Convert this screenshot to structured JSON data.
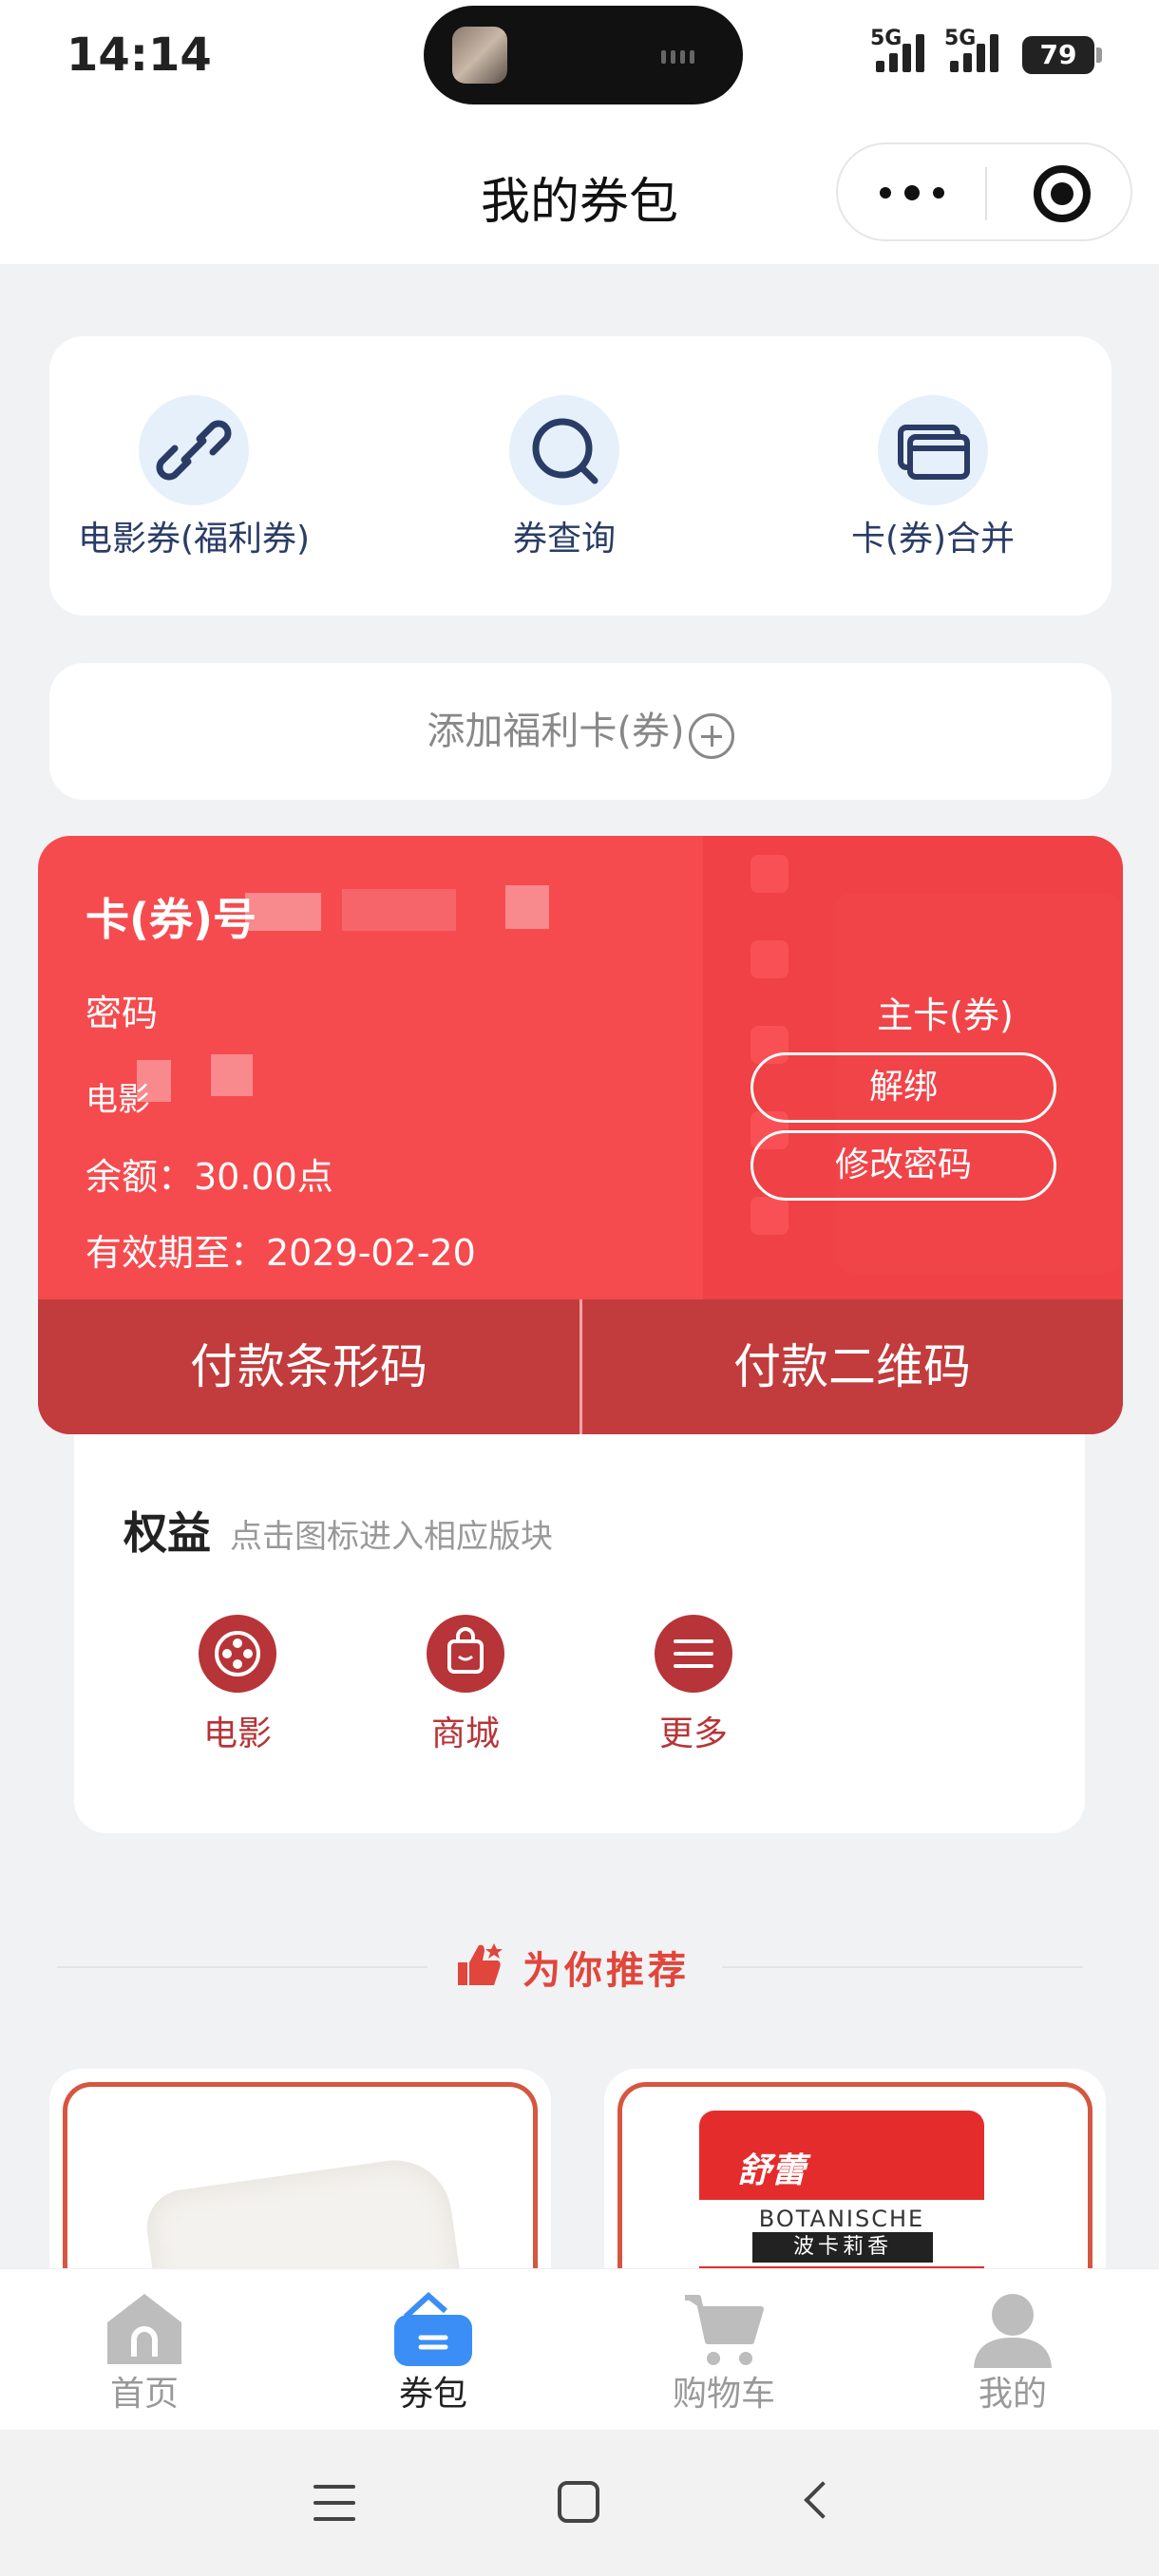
{
  "status_bar": {
    "time": "14:14",
    "signal1": "5G",
    "signal2": "5G",
    "battery": "79"
  },
  "header": {
    "title": "我的券包"
  },
  "quick_actions": [
    {
      "label": "电影券(福利券)",
      "icon": "link-icon"
    },
    {
      "label": "券查询",
      "icon": "search-icon"
    },
    {
      "label": "卡(券)合并",
      "icon": "cards-icon"
    }
  ],
  "add_card": {
    "label": "添加福利卡(券)"
  },
  "card": {
    "number_label": "卡(券)号",
    "password_label": "密码",
    "type_label": "电影",
    "balance": "余额：30.00点",
    "expiry": "有效期至：2029-02-20",
    "main_card_label": "主卡(券)",
    "unbind_button": "解绑",
    "change_password_button": "修改密码",
    "pay_barcode": "付款条形码",
    "pay_qrcode": "付款二维码",
    "accent_color": "#f54b4f"
  },
  "rights": {
    "title": "权益",
    "subtitle": "点击图标进入相应版块",
    "items": [
      {
        "label": "电影",
        "icon": "film-reel-icon"
      },
      {
        "label": "商城",
        "icon": "shopping-bag-icon"
      },
      {
        "label": "更多",
        "icon": "menu-icon"
      }
    ]
  },
  "recommend": {
    "title": "为你推荐"
  },
  "products": [
    {
      "image": "tissue-paper"
    },
    {
      "brand_cn": "舒蕾",
      "brand_en": "BOTANISCHE",
      "variant": "波卡莉香"
    }
  ],
  "tabbar": [
    {
      "label": "首页",
      "icon": "home-icon",
      "active": false
    },
    {
      "label": "券包",
      "icon": "wallet-icon",
      "active": true
    },
    {
      "label": "购物车",
      "icon": "cart-icon",
      "active": false
    },
    {
      "label": "我的",
      "icon": "user-icon",
      "active": false
    }
  ]
}
